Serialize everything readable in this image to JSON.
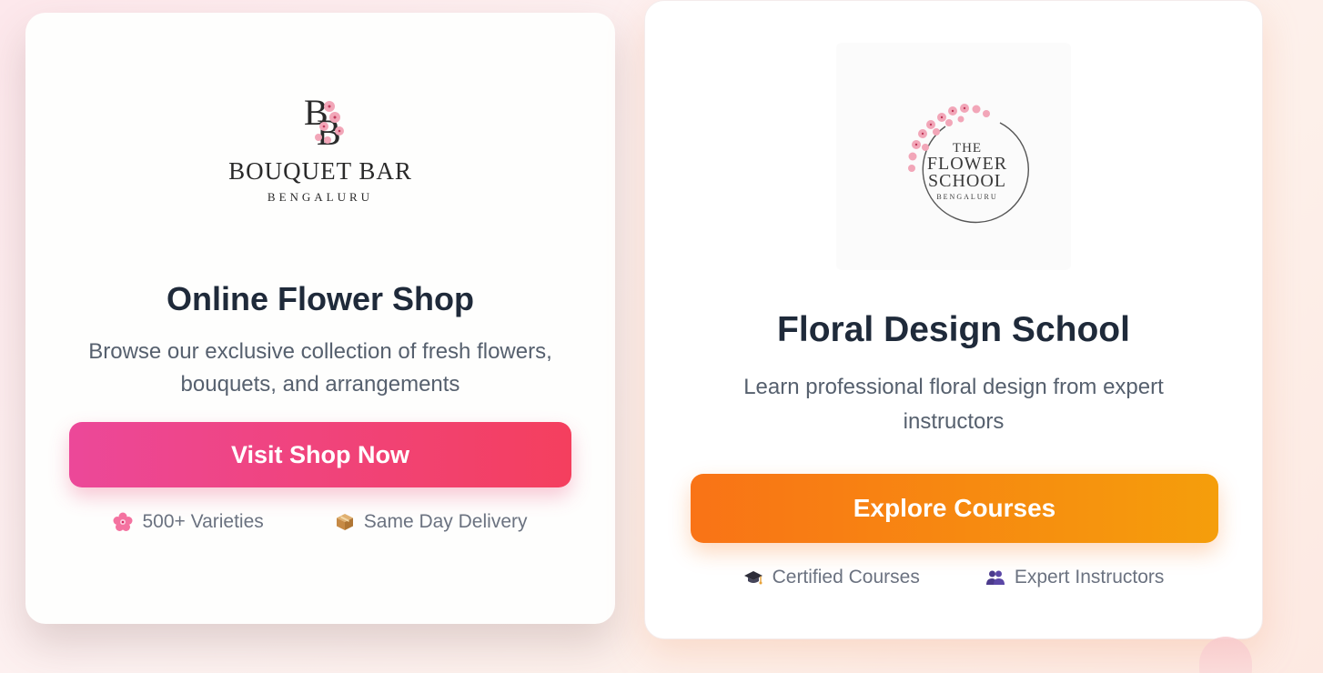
{
  "shop_card": {
    "logo": {
      "monogram": "BB",
      "name": "BOUQUET BAR",
      "city": "BENGALURU"
    },
    "title": "Online Flower Shop",
    "description": "Browse our exclusive collection of fresh flowers, bouquets, and arrangements",
    "cta_label": "Visit Shop Now",
    "features": [
      {
        "icon": "cherry-blossom-icon",
        "label": "500+ Varieties"
      },
      {
        "icon": "package-icon",
        "label": "Same Day Delivery"
      }
    ],
    "accent_colors": [
      "#ec4899",
      "#f43f5e"
    ]
  },
  "school_card": {
    "logo": {
      "line1": "THE",
      "line2": "FLOWER",
      "line3": "SCHOOL",
      "city": "BENGALURU"
    },
    "title": "Floral Design School",
    "description": "Learn professional floral design from expert instructors",
    "cta_label": "Explore Courses",
    "features": [
      {
        "icon": "graduation-cap-icon",
        "label": "Certified Courses"
      },
      {
        "icon": "people-icon",
        "label": "Expert Instructors"
      }
    ],
    "accent_colors": [
      "#f97316",
      "#f59e0b"
    ]
  }
}
